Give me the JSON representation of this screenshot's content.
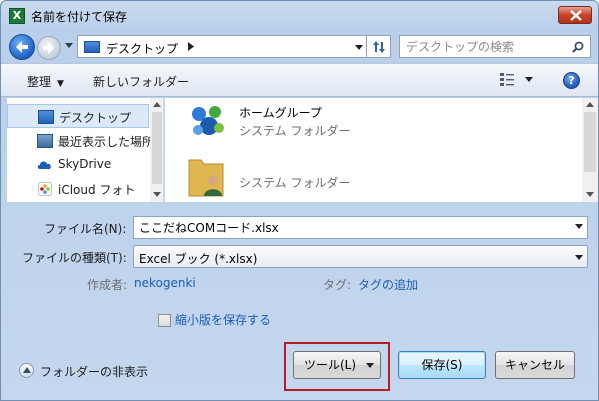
{
  "window": {
    "title": "名前を付けて保存",
    "app_icon_letter": "X",
    "app_icon_color": "#1d7a3a",
    "close_button_color": "#c8422a"
  },
  "navbar": {
    "address_location": "デスクトップ",
    "search_placeholder": "デスクトップの検索"
  },
  "toolbar": {
    "organize_label": "整理",
    "new_folder_label": "新しいフォルダー",
    "help_label": "?"
  },
  "nav_pane": {
    "items": [
      {
        "label": "デスクトップ",
        "icon": "desktop-icon",
        "selected": true
      },
      {
        "label": "最近表示した場所",
        "icon": "recent-places-icon",
        "selected": false
      },
      {
        "label": "SkyDrive",
        "icon": "skydrive-icon",
        "selected": false
      },
      {
        "label": "iCloud フォト",
        "icon": "icloud-photos-icon",
        "selected": false
      }
    ]
  },
  "file_pane": {
    "items": [
      {
        "name": "ホームグループ",
        "type": "システム フォルダー",
        "icon": "homegroup-icon"
      },
      {
        "name": "",
        "type": "システム フォルダー",
        "icon": "user-folder-icon"
      }
    ]
  },
  "form": {
    "file_name_label": "ファイル名(N):",
    "file_name_value": "ここだねCOMコード.xlsx",
    "file_type_label": "ファイルの種類(T):",
    "file_type_value": "Excel ブック (*.xlsx)",
    "author_label": "作成者:",
    "author_value": "nekogenki",
    "tags_label": "タグ:",
    "tags_value": "タグの追加",
    "save_thumbnail_label": "縮小版を保存する",
    "save_thumbnail_checked": false
  },
  "footer": {
    "hide_folders_label": "フォルダーの非表示",
    "tools_label": "ツール(L)",
    "save_label": "保存(S)",
    "cancel_label": "キャンセル",
    "highlight_color": "#b51e24"
  }
}
